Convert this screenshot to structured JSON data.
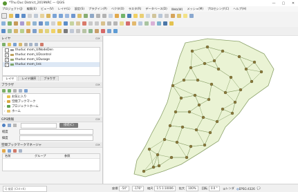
{
  "window": {
    "title": "*Thu Duc District_2019NRC — QGIS",
    "controls": [
      "—",
      "▢",
      "✕"
    ]
  },
  "menubar": [
    "プロジェクト(J)",
    "編集(E)",
    "ビュー(V)",
    "レイヤ(L)",
    "設定(S)",
    "プラグイン(P)",
    "ベクタ(O)",
    "ラスタ(R)",
    "データベース(D)",
    "Web(W)",
    "メッシュ(M)",
    "プロセシング(C)",
    "ヘルプ(H)"
  ],
  "layers_panel": {
    "title": "レイヤ",
    "items": [
      {
        "label": "thuduc mom_UINodeDen",
        "checked": false,
        "color": "#9b9b9b"
      },
      {
        "label": "thuduc mom_UDcontrol",
        "checked": true,
        "color": "#c0a35e"
      },
      {
        "label": "thuduc mom_UDusage",
        "checked": true,
        "color": "#9aa873"
      },
      {
        "label": "thuduc mom_link",
        "checked": true,
        "color": "#7ea66a",
        "selected": true
      }
    ],
    "tabs": [
      "レイヤ",
      "レイヤ順序",
      "ブラウザ"
    ]
  },
  "browser_panel": {
    "title": "ブラウザ",
    "items": [
      {
        "label": "お気に入り",
        "icon_color": "#e8c14a"
      },
      {
        "label": "空間ブックマーク",
        "icon_color": "#d9a740"
      },
      {
        "label": "プロジェクトホーム",
        "icon_color": "#5fa051"
      },
      {
        "label": "ホーム",
        "icon_color": "#e3c26c"
      }
    ]
  },
  "gps_panel": {
    "title": "GPS情報",
    "connect_button": "接続(C)",
    "label_position": "経度",
    "label_lat": "緯度"
  },
  "bookmarks_panel": {
    "title": "空間ブックマークマネージャ",
    "columns": [
      "名前",
      "グループ",
      "参照"
    ]
  },
  "statusbar": {
    "search_placeholder": "Q 検索 (Ctrl+K)",
    "coord_label": "座標",
    "coord_value": "-54°",
    "coord_value2": "-176°",
    "scale_label": "縮尺",
    "scale_value": "1:5 1:10006",
    "magnifier_label": "拡大",
    "magnifier_value": "100%",
    "rotation_label": "回転",
    "rotation_value": "0.0 °",
    "render_label": "レンダ",
    "crs_label": "EPSG:4326"
  },
  "colors": {
    "map_fill": "#eaf3d4",
    "map_stroke": "#8aa168",
    "point_fill": "#8a7a3a",
    "accent": "#589632"
  }
}
